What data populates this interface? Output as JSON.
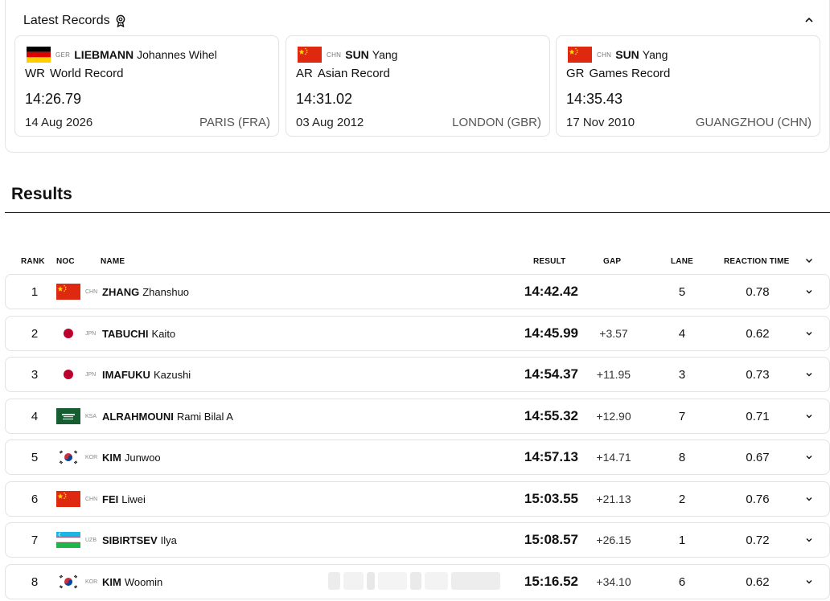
{
  "latest_records": {
    "title": "Latest Records",
    "cards": [
      {
        "flag": "GER",
        "noc": "GER",
        "surname": "LIEBMANN",
        "given_name": "Johannes Wihel",
        "abbr": "WR",
        "record_name": "World Record",
        "time": "14:26.79",
        "date": "14 Aug 2026",
        "place": "PARIS (FRA)"
      },
      {
        "flag": "CHN",
        "noc": "CHN",
        "surname": "SUN",
        "given_name": "Yang",
        "abbr": "AR",
        "record_name": "Asian Record",
        "time": "14:31.02",
        "date": "03 Aug 2012",
        "place": "LONDON (GBR)"
      },
      {
        "flag": "CHN",
        "noc": "CHN",
        "surname": "SUN",
        "given_name": "Yang",
        "abbr": "GR",
        "record_name": "Games Record",
        "time": "14:35.43",
        "date": "17 Nov 2010",
        "place": "GUANGZHOU (CHN)"
      }
    ]
  },
  "results": {
    "title": "Results",
    "columns": {
      "rank": "RANK",
      "noc": "NOC",
      "name": "NAME",
      "result": "RESULT",
      "gap": "GAP",
      "lane": "LANE",
      "reaction": "REACTION TIME"
    },
    "rows": [
      {
        "rank": "1",
        "flag": "CHN",
        "noc": "CHN",
        "surname": "ZHANG",
        "given_name": "Zhanshuo",
        "result": "14:42.42",
        "gap": "",
        "lane": "5",
        "reaction": "0.78"
      },
      {
        "rank": "2",
        "flag": "JPN",
        "noc": "JPN",
        "surname": "TABUCHI",
        "given_name": "Kaito",
        "result": "14:45.99",
        "gap": "+3.57",
        "lane": "4",
        "reaction": "0.62"
      },
      {
        "rank": "3",
        "flag": "JPN",
        "noc": "JPN",
        "surname": "IMAFUKU",
        "given_name": "Kazushi",
        "result": "14:54.37",
        "gap": "+11.95",
        "lane": "3",
        "reaction": "0.73"
      },
      {
        "rank": "4",
        "flag": "KSA",
        "noc": "KSA",
        "surname": "ALRAHMOUNI",
        "given_name": "Rami Bilal A",
        "result": "14:55.32",
        "gap": "+12.90",
        "lane": "7",
        "reaction": "0.71"
      },
      {
        "rank": "5",
        "flag": "KOR",
        "noc": "KOR",
        "surname": "KIM",
        "given_name": "Junwoo",
        "result": "14:57.13",
        "gap": "+14.71",
        "lane": "8",
        "reaction": "0.67"
      },
      {
        "rank": "6",
        "flag": "CHN",
        "noc": "CHN",
        "surname": "FEI",
        "given_name": "Liwei",
        "result": "15:03.55",
        "gap": "+21.13",
        "lane": "2",
        "reaction": "0.76"
      },
      {
        "rank": "7",
        "flag": "UZB",
        "noc": "UZB",
        "surname": "SIBIRTSEV",
        "given_name": "Ilya",
        "result": "15:08.57",
        "gap": "+26.15",
        "lane": "1",
        "reaction": "0.72"
      },
      {
        "rank": "8",
        "flag": "KOR",
        "noc": "KOR",
        "surname": "KIM",
        "given_name": "Woomin",
        "result": "15:16.52",
        "gap": "+34.10",
        "lane": "6",
        "reaction": "0.62"
      }
    ]
  },
  "icons": {
    "records": "medal-icon",
    "collapse": "chevron-up-icon",
    "row_expand": "chevron-down-icon"
  },
  "colors": {
    "border": "#e2e2e2",
    "text": "#111111",
    "muted": "#777777"
  }
}
